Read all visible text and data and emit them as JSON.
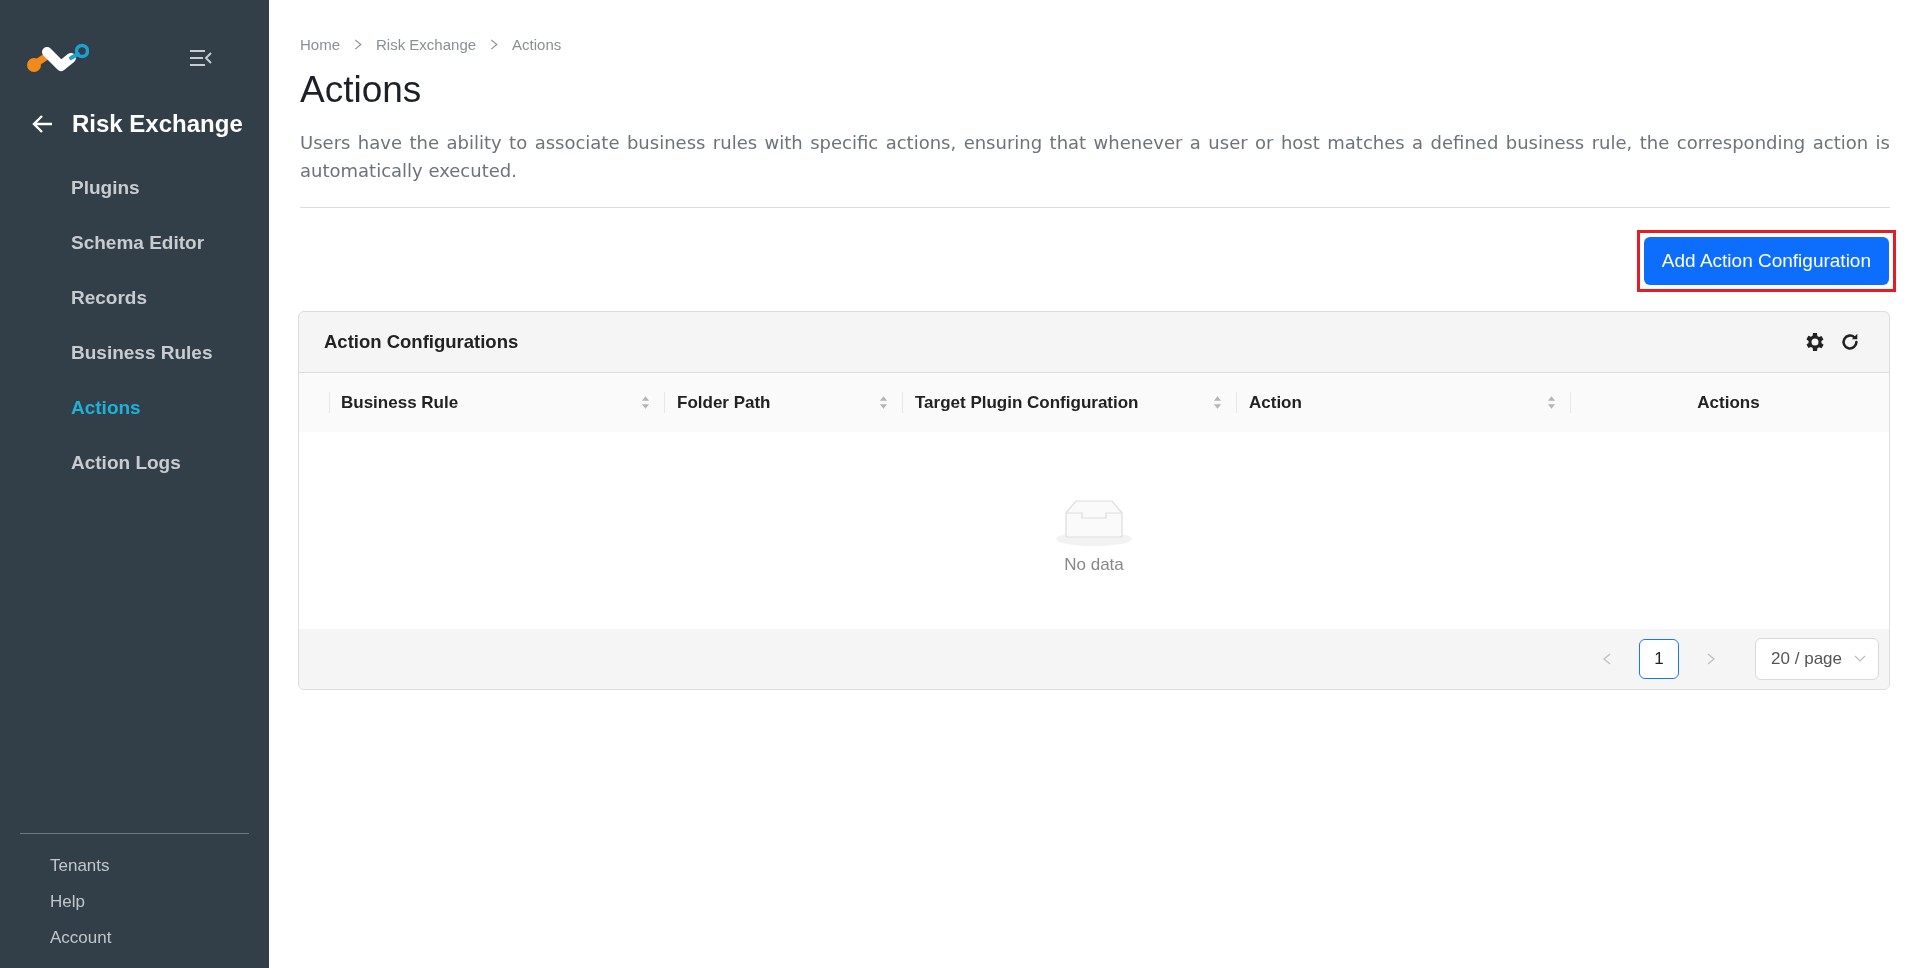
{
  "sidebar": {
    "section_title": "Risk Exchange",
    "items": [
      {
        "label": "Plugins",
        "selected": false
      },
      {
        "label": "Schema Editor",
        "selected": false
      },
      {
        "label": "Records",
        "selected": false
      },
      {
        "label": "Business Rules",
        "selected": false
      },
      {
        "label": "Actions",
        "selected": true
      },
      {
        "label": "Action Logs",
        "selected": false
      }
    ],
    "footer_links": [
      "Tenants",
      "Help",
      "Account"
    ]
  },
  "breadcrumb": [
    {
      "label": "Home"
    },
    {
      "label": "Risk Exchange"
    },
    {
      "label": "Actions"
    }
  ],
  "page_title": "Actions",
  "description": "Users have the ability to associate business rules with specific actions, ensuring that whenever a user or host matches a defined business rule, the corresponding action is automatically executed.",
  "primary_button": {
    "label": "Add Action Configuration",
    "highlighted": true
  },
  "table": {
    "title": "Action Configurations",
    "columns": [
      {
        "label": "Business Rule",
        "sortable": true
      },
      {
        "label": "Folder Path",
        "sortable": true
      },
      {
        "label": "Target Plugin Configuration",
        "sortable": true
      },
      {
        "label": "Action",
        "sortable": true
      },
      {
        "label": "Actions",
        "sortable": false
      }
    ],
    "empty_text": "No data",
    "pagination": {
      "pages": [
        {
          "label": "1",
          "selected": true
        }
      ],
      "page_size": "20 / page"
    }
  }
}
